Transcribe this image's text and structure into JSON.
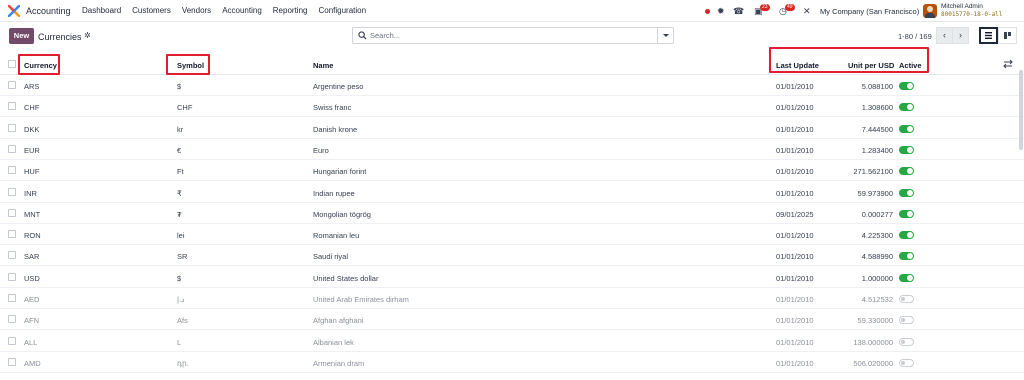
{
  "navbar": {
    "app_name": "Accounting",
    "menu": [
      "Dashboard",
      "Customers",
      "Vendors",
      "Accounting",
      "Reporting",
      "Configuration"
    ],
    "discuss_badge": "23",
    "activity_badge": "49",
    "company": "My Company (San Francisco)",
    "user_name": "Mitchell Admin",
    "db_name": "80015770-18-0-all"
  },
  "control": {
    "new_label": "New",
    "title": "Currencies",
    "search_placeholder": "Search...",
    "pager": "1-80 / 169"
  },
  "table": {
    "headers": {
      "currency": "Currency",
      "symbol": "Symbol",
      "name": "Name",
      "last_update": "Last Update",
      "rate": "Unit per USD",
      "active": "Active"
    },
    "rows": [
      {
        "currency": "ARS",
        "symbol": "$",
        "name": "Argentine peso",
        "last_update": "01/01/2010",
        "rate": "5.088100",
        "active": true
      },
      {
        "currency": "CHF",
        "symbol": "CHF",
        "name": "Swiss franc",
        "last_update": "01/01/2010",
        "rate": "1.308600",
        "active": true
      },
      {
        "currency": "DKK",
        "symbol": "kr",
        "name": "Danish krone",
        "last_update": "01/01/2010",
        "rate": "7.444500",
        "active": true
      },
      {
        "currency": "EUR",
        "symbol": "€",
        "name": "Euro",
        "last_update": "01/01/2010",
        "rate": "1.283400",
        "active": true
      },
      {
        "currency": "HUF",
        "symbol": "Ft",
        "name": "Hungarian forint",
        "last_update": "01/01/2010",
        "rate": "271.562100",
        "active": true
      },
      {
        "currency": "INR",
        "symbol": "₹",
        "name": "Indian rupee",
        "last_update": "01/01/2010",
        "rate": "59.973900",
        "active": true
      },
      {
        "currency": "MNT",
        "symbol": "₮",
        "name": "Mongolian tögrög",
        "last_update": "09/01/2025",
        "rate": "0.000277",
        "active": true
      },
      {
        "currency": "RON",
        "symbol": "lei",
        "name": "Romanian leu",
        "last_update": "01/01/2010",
        "rate": "4.225300",
        "active": true
      },
      {
        "currency": "SAR",
        "symbol": "SR",
        "name": "Saudi riyal",
        "last_update": "01/01/2010",
        "rate": "4.588990",
        "active": true
      },
      {
        "currency": "USD",
        "symbol": "$",
        "name": "United States dollar",
        "last_update": "01/01/2010",
        "rate": "1.000000",
        "active": true
      },
      {
        "currency": "AED",
        "symbol": "د.إ",
        "name": "United Arab Emirates dirham",
        "last_update": "01/01/2010",
        "rate": "4.512532",
        "active": false
      },
      {
        "currency": "AFN",
        "symbol": "Afs",
        "name": "Afghan afghani",
        "last_update": "01/01/2010",
        "rate": "59.330000",
        "active": false
      },
      {
        "currency": "ALL",
        "symbol": "L",
        "name": "Albanian lek",
        "last_update": "01/01/2010",
        "rate": "138.000000",
        "active": false
      },
      {
        "currency": "AMD",
        "symbol": "դր.",
        "name": "Armenian dram",
        "last_update": "01/01/2010",
        "rate": "506.020000",
        "active": false
      }
    ]
  },
  "colors": {
    "brand": "#714b67",
    "toggle_on": "#28a745",
    "highlight": "#e11d2e",
    "badge": "#dc2626"
  }
}
